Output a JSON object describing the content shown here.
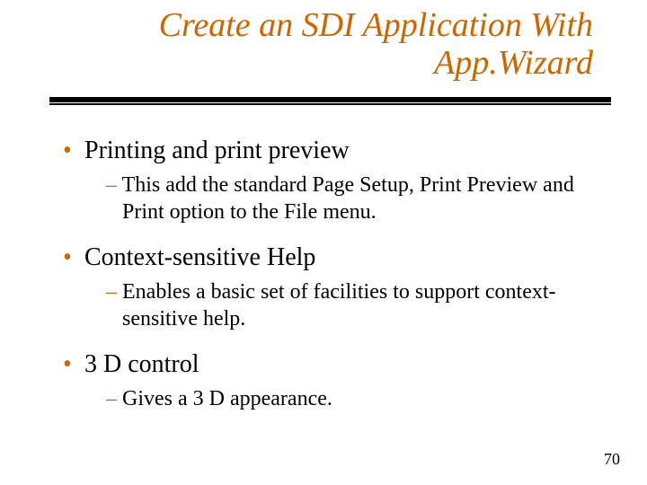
{
  "title_line1": "Create an SDI Application With",
  "title_line2": "App.Wizard",
  "items": [
    {
      "heading": "Printing and print preview",
      "detail": "This add the standard Page Setup, Print Preview and Print option to the File menu."
    },
    {
      "heading": "Context-sensitive Help",
      "detail": "Enables a basic set of facilities to support context-sensitive help."
    },
    {
      "heading": "3 D control",
      "detail": "Gives a 3 D appearance."
    }
  ],
  "page_number": "70"
}
